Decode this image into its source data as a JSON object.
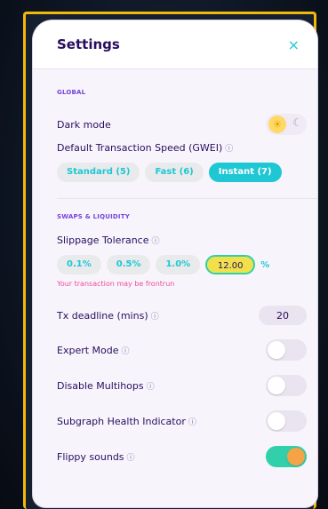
{
  "settings": {
    "title": "Settings",
    "close_icon": "×",
    "global": {
      "label": "GLOBAL",
      "dark_mode_label": "Dark mode",
      "dark_mode_state": "light",
      "speed_label": "Default Transaction Speed (GWEI)",
      "speed_options": [
        "Standard (5)",
        "Fast (6)",
        "Instant (7)"
      ],
      "speed_selected": "Instant (7)"
    },
    "swaps": {
      "label": "SWAPS & LIQUIDITY",
      "slippage_label": "Slippage Tolerance",
      "slippage_options": [
        "0.1%",
        "0.5%",
        "1.0%"
      ],
      "slippage_value": "12.00",
      "slippage_unit": "%",
      "slippage_warning": "Your transaction may be frontrun",
      "deadline_label": "Tx deadline (mins)",
      "deadline_value": "20",
      "expert_mode_label": "Expert Mode",
      "expert_mode_on": false,
      "multihops_label": "Disable Multihops",
      "multihops_on": false,
      "subgraph_label": "Subgraph Health Indicator",
      "subgraph_on": false,
      "flippy_label": "Flippy sounds",
      "flippy_on": true
    },
    "help_icon": "?"
  },
  "colors": {
    "accent": "#1fc7d4",
    "title": "#280d5f",
    "section": "#7645d9",
    "warning": "#ed4b9e",
    "highlight": "#f0e14c",
    "frame": "#f0b90b",
    "toggle_on": "#31d0aa"
  }
}
